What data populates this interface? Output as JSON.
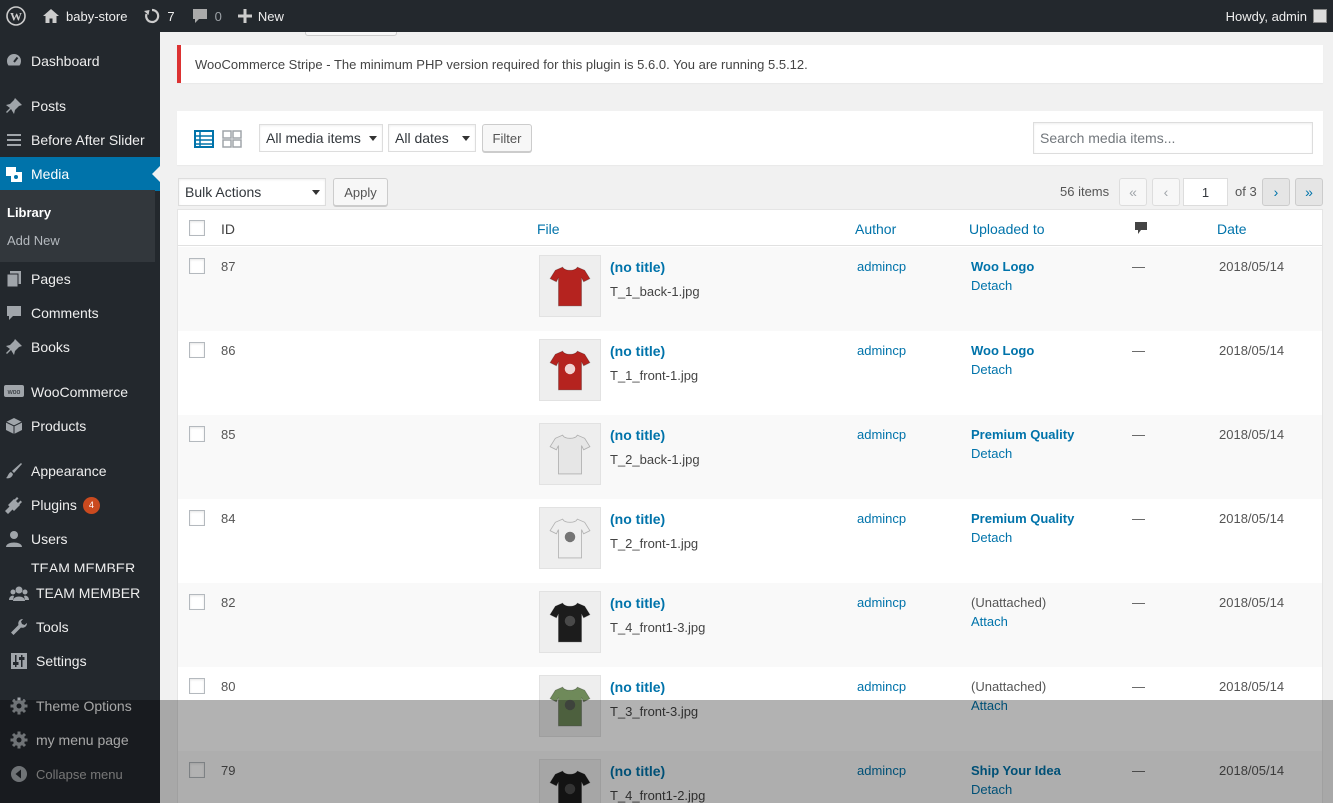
{
  "adminbar": {
    "site_name": "baby-store",
    "updates_count": "7",
    "comments_count": "0",
    "new_label": "New",
    "greeting": "Howdy, admin"
  },
  "sidebar": {
    "items": [
      {
        "label": "Dashboard",
        "icon": "dashboard-icon"
      },
      {
        "label": "Posts",
        "icon": "pin-icon"
      },
      {
        "label": "Before After Slider",
        "icon": "list-icon"
      },
      {
        "label": "Media",
        "icon": "media-icon"
      },
      {
        "label": "Pages",
        "icon": "pages-icon"
      },
      {
        "label": "Comments",
        "icon": "comment-icon"
      },
      {
        "label": "Books",
        "icon": "pin-icon"
      },
      {
        "label": "WooCommerce",
        "icon": "woo-icon"
      },
      {
        "label": "Products",
        "icon": "box-icon"
      },
      {
        "label": "Appearance",
        "icon": "brush-icon"
      },
      {
        "label": "Plugins",
        "icon": "plug-icon",
        "badge": "4"
      },
      {
        "label": "Users",
        "icon": "user-icon"
      },
      {
        "label": "TEAM MEMBER",
        "icon": "group-icon"
      },
      {
        "label": "Tools",
        "icon": "wrench-icon"
      },
      {
        "label": "Settings",
        "icon": "sliders-icon"
      },
      {
        "label": "Theme Options",
        "icon": "gear-icon"
      },
      {
        "label": "my menu page",
        "icon": "gear-icon"
      },
      {
        "label": "Collapse menu",
        "icon": "collapse-icon"
      }
    ],
    "submenu": {
      "library": "Library",
      "add_new": "Add New"
    },
    "clipped_label": "TEAM MEMBER"
  },
  "notice": {
    "text": "WooCommerce Stripe - The minimum PHP version required for this plugin is 5.6.0. You are running 5.5.12."
  },
  "filters": {
    "media_type": "All media items",
    "dates": "All dates",
    "filter_button": "Filter",
    "search_placeholder": "Search media items..."
  },
  "bulk": {
    "action": "Bulk Actions",
    "apply": "Apply"
  },
  "pagination": {
    "items_count": "56 items",
    "first": "«",
    "prev": "‹",
    "current_page": "1",
    "of_text": "of 3",
    "next": "›",
    "last": "»"
  },
  "table": {
    "columns": {
      "id": "ID",
      "file": "File",
      "author": "Author",
      "uploaded_to": "Uploaded to",
      "date": "Date"
    },
    "rows": [
      {
        "id": "87",
        "title": "(no title)",
        "file": "T_1_back-1.jpg",
        "author": "admincp",
        "uploaded": "Woo Logo",
        "action": "Detach",
        "comments": "—",
        "date": "2018/05/14",
        "shirt_color": "#b5231f",
        "print": false
      },
      {
        "id": "86",
        "title": "(no title)",
        "file": "T_1_front-1.jpg",
        "author": "admincp",
        "uploaded": "Woo Logo",
        "action": "Detach",
        "comments": "—",
        "date": "2018/05/14",
        "shirt_color": "#b5231f",
        "print": true
      },
      {
        "id": "85",
        "title": "(no title)",
        "file": "T_2_back-1.jpg",
        "author": "admincp",
        "uploaded": "Premium Quality",
        "action": "Detach",
        "comments": "—",
        "date": "2018/05/14",
        "shirt_color": "#e6e6e6",
        "print": false
      },
      {
        "id": "84",
        "title": "(no title)",
        "file": "T_2_front-1.jpg",
        "author": "admincp",
        "uploaded": "Premium Quality",
        "action": "Detach",
        "comments": "—",
        "date": "2018/05/14",
        "shirt_color": "#eeeeee",
        "print": true
      },
      {
        "id": "82",
        "title": "(no title)",
        "file": "T_4_front1-3.jpg",
        "author": "admincp",
        "uploaded": "(Unattached)",
        "action": "Attach",
        "comments": "—",
        "date": "2018/05/14",
        "shirt_color": "#1c1c1c",
        "print": true
      },
      {
        "id": "80",
        "title": "(no title)",
        "file": "T_3_front-3.jpg",
        "author": "admincp",
        "uploaded": "(Unattached)",
        "action": "Attach",
        "comments": "—",
        "date": "2018/05/14",
        "shirt_color": "#6f8a5a",
        "print": true
      },
      {
        "id": "79",
        "title": "(no title)",
        "file": "T_4_front1-2.jpg",
        "author": "admincp",
        "uploaded": "Ship Your Idea",
        "action": "Detach",
        "comments": "—",
        "date": "2018/05/14",
        "shirt_color": "#1c1c1c",
        "print": true
      }
    ]
  },
  "colors": {
    "accent": "#0073aa",
    "sidebar_bg": "#23282d",
    "notice_error": "#dc3232"
  }
}
